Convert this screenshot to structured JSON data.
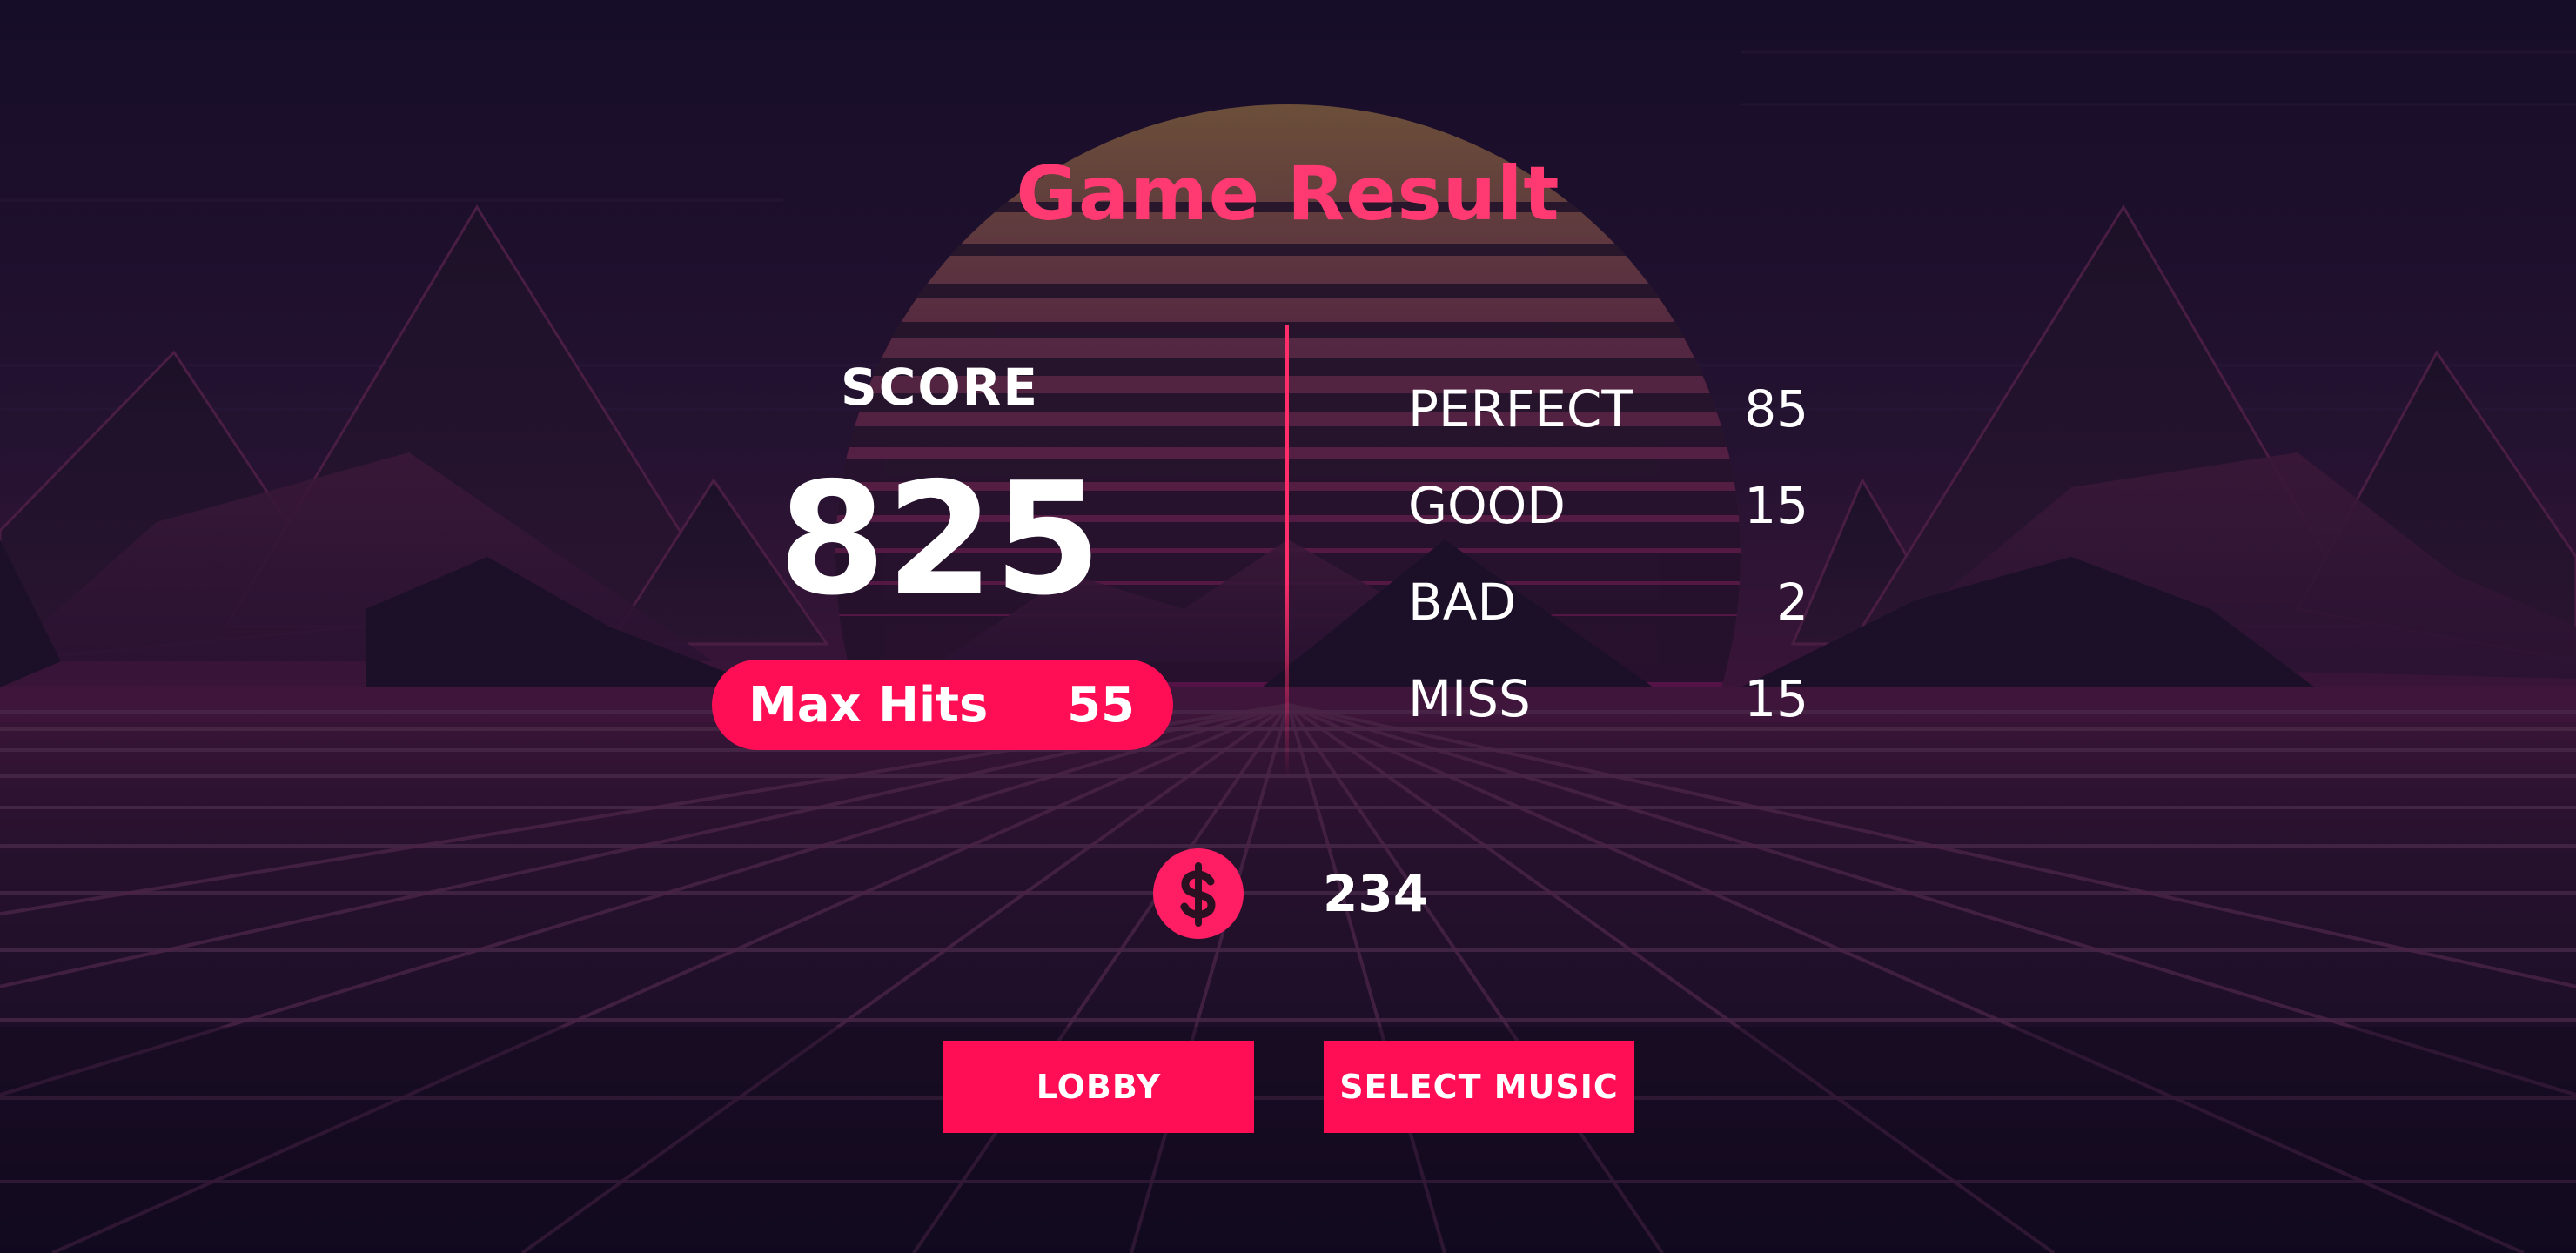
{
  "result": {
    "title": "Game Result",
    "score_label": "SCORE",
    "score": "825",
    "max_hits_label": "Max Hits",
    "max_hits": "55"
  },
  "judgements": [
    {
      "label": "PERFECT",
      "count": "85"
    },
    {
      "label": "GOOD",
      "count": "15"
    },
    {
      "label": "BAD",
      "count": "2"
    },
    {
      "label": "MISS",
      "count": "15"
    }
  ],
  "reward": {
    "icon": "dollar-coin-icon",
    "coins": "234"
  },
  "buttons": {
    "lobby": "LOBBY",
    "select_music": "SELECT MUSIC"
  },
  "colors": {
    "accent": "#ff0e56",
    "title": "#ff3a72",
    "background": "#140d24"
  }
}
